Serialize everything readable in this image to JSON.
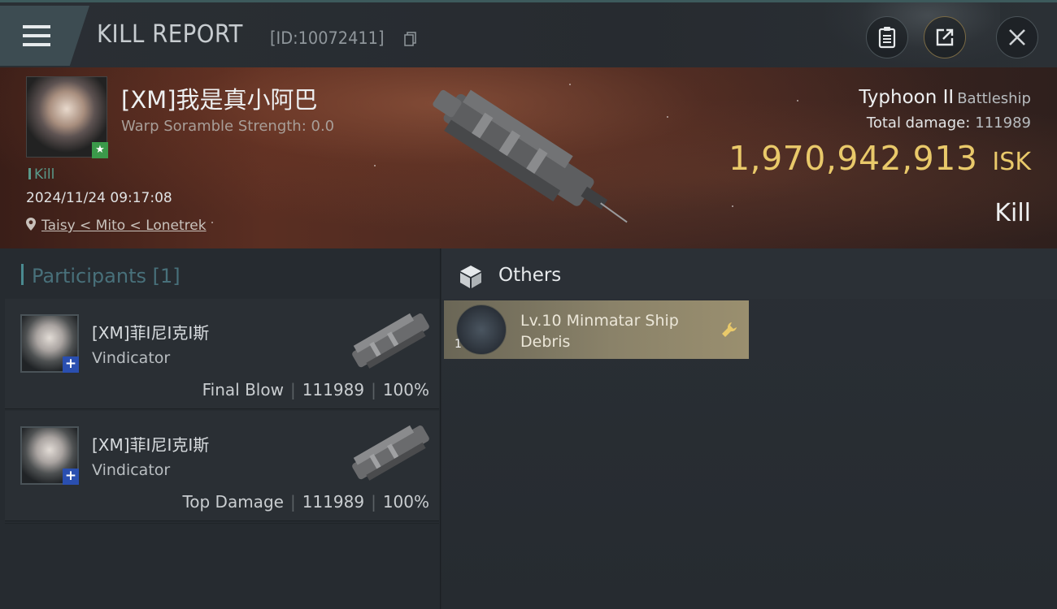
{
  "header": {
    "title": "KILL REPORT",
    "report_id": "[ID:10072411]"
  },
  "victim": {
    "name": "[XM]我是真小阿巴",
    "scramble": "Warp Soramble Strength: 0.0",
    "status_tag": "Kill",
    "time": "2024/11/24 09:17:08",
    "location": "Taisy < Mito < Lonetrek",
    "ship_name": "Typhoon II",
    "ship_class": "Battleship",
    "total_damage_label": "Total damage:",
    "total_damage": "111989",
    "isk_value": "1,970,942,913",
    "isk_unit": "ISK",
    "result": "Kill"
  },
  "participants": {
    "label": "Participants",
    "count": "[1]",
    "items": [
      {
        "name": "[XM]菲I尼I克I斯",
        "ship": "Vindicator",
        "role": "Final Blow",
        "damage": "111989",
        "percent": "100%"
      },
      {
        "name": "[XM]菲I尼I克I斯",
        "ship": "Vindicator",
        "role": "Top Damage",
        "damage": "111989",
        "percent": "100%"
      }
    ]
  },
  "others": {
    "title": "Others",
    "items": [
      {
        "name": "Lv.10 Minmatar Ship Debris",
        "qty": "1"
      }
    ]
  },
  "colors": {
    "isk": "#e9c96a",
    "participants_accent": "#4a8a90",
    "item_card": "#8a8269"
  },
  "icons": [
    "menu-icon",
    "copy-icon",
    "clipboard-icon",
    "share-icon",
    "close-icon",
    "location-pin-icon",
    "star-icon",
    "plus-icon",
    "box-icon",
    "wrench-icon"
  ]
}
